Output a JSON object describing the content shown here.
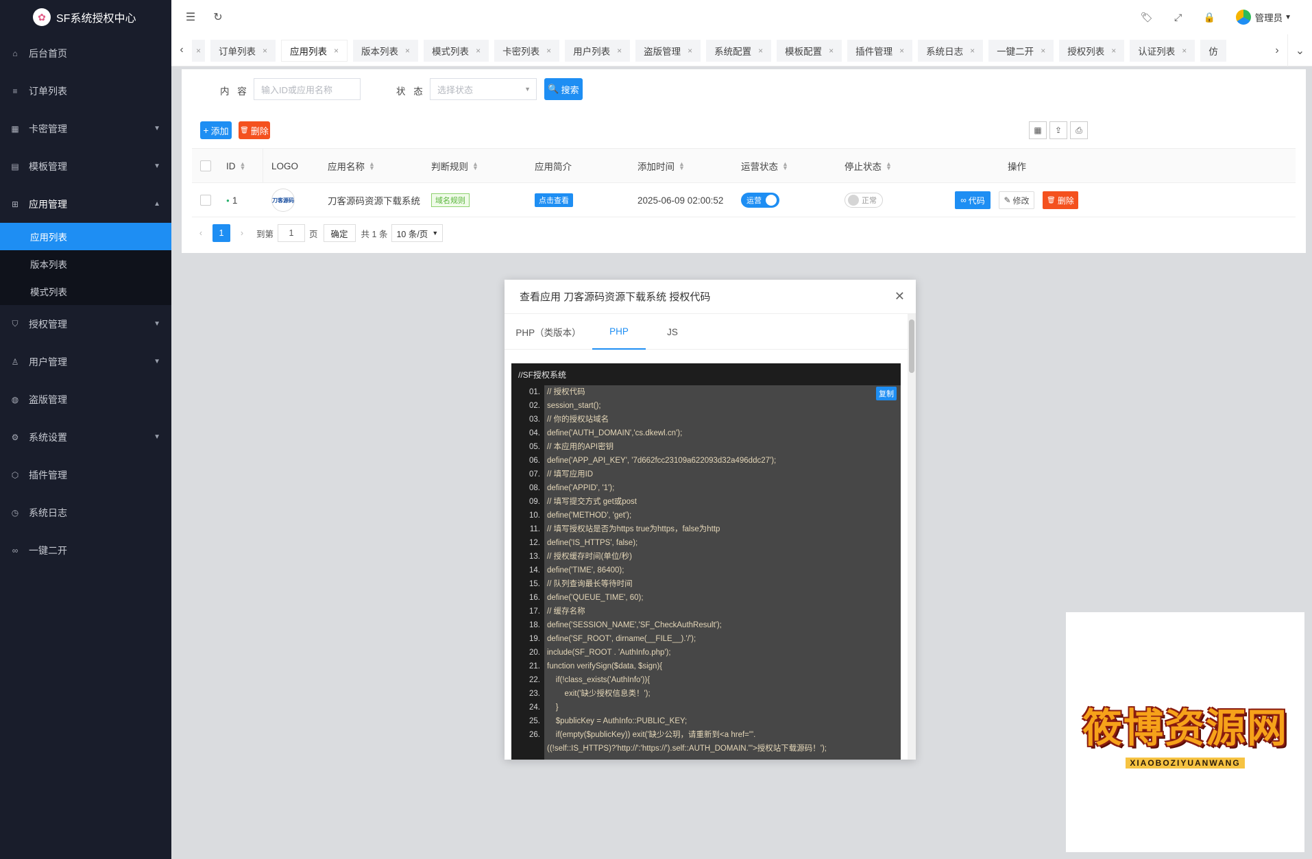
{
  "app": {
    "title": "SF系统授权中心"
  },
  "sidebar": {
    "items": [
      {
        "label": "后台首页",
        "icon": "home-icon",
        "has_children": false
      },
      {
        "label": "订单列表",
        "icon": "list-icon",
        "has_children": false
      },
      {
        "label": "卡密管理",
        "icon": "grid-icon",
        "has_children": true
      },
      {
        "label": "模板管理",
        "icon": "template-icon",
        "has_children": true
      },
      {
        "label": "应用管理",
        "icon": "apps-icon",
        "has_children": true,
        "open": true
      },
      {
        "label": "授权管理",
        "icon": "shield-icon",
        "has_children": true
      },
      {
        "label": "用户管理",
        "icon": "user-icon",
        "has_children": true
      },
      {
        "label": "盗版管理",
        "icon": "globe-icon",
        "has_children": false
      },
      {
        "label": "系统设置",
        "icon": "gear-icon",
        "has_children": true
      },
      {
        "label": "插件管理",
        "icon": "cube-icon",
        "has_children": false
      },
      {
        "label": "系统日志",
        "icon": "clock-icon",
        "has_children": false
      },
      {
        "label": "一键二开",
        "icon": "infinity-icon",
        "has_children": false
      }
    ],
    "sub_items": [
      {
        "label": "应用列表",
        "active": true
      },
      {
        "label": "版本列表",
        "active": false
      },
      {
        "label": "模式列表",
        "active": false
      }
    ]
  },
  "header": {
    "user": "管理员"
  },
  "tabs": [
    {
      "label": "订单列表",
      "active": false
    },
    {
      "label": "应用列表",
      "active": true
    },
    {
      "label": "版本列表",
      "active": false
    },
    {
      "label": "模式列表",
      "active": false
    },
    {
      "label": "卡密列表",
      "active": false
    },
    {
      "label": "用户列表",
      "active": false
    },
    {
      "label": "盗版管理",
      "active": false
    },
    {
      "label": "系统配置",
      "active": false
    },
    {
      "label": "模板配置",
      "active": false
    },
    {
      "label": "插件管理",
      "active": false
    },
    {
      "label": "系统日志",
      "active": false
    },
    {
      "label": "一键二开",
      "active": false
    },
    {
      "label": "授权列表",
      "active": false
    },
    {
      "label": "认证列表",
      "active": false
    },
    {
      "label": "仿",
      "active": false
    }
  ],
  "search": {
    "content_label": "内 容",
    "content_placeholder": "输入ID或应用名称",
    "status_label": "状 态",
    "status_placeholder": "选择状态",
    "button": "搜索"
  },
  "toolbar": {
    "add": "添加",
    "delete": "删除"
  },
  "table": {
    "headers": [
      "ID",
      "LOGO",
      "应用名称",
      "判断规则",
      "应用简介",
      "添加时间",
      "运营状态",
      "停止状态",
      "操作"
    ],
    "rows": [
      {
        "id": "1",
        "logo_text": "刀客源码",
        "name": "刀客源码资源下载系统",
        "rule": "域名规则",
        "intro": "点击查看",
        "time": "2025-06-09 02:00:52",
        "operate": "运营",
        "stop": "正常",
        "actions": {
          "code": "代码",
          "edit": "修改",
          "delete": "删除"
        }
      }
    ]
  },
  "pager": {
    "current": "1",
    "goto_label": "到第",
    "page_input": "1",
    "page_suffix": "页",
    "confirm": "确定",
    "total": "共 1 条",
    "per_page": "10 条/页"
  },
  "modal": {
    "title": "查看应用 刀客源码资源下载系统 授权代码",
    "tabs": [
      {
        "label": "PHP（类版本）",
        "active": false
      },
      {
        "label": "PHP",
        "active": true
      },
      {
        "label": "JS",
        "active": false
      }
    ],
    "code_title": "//SF授权系统",
    "copy": "复制",
    "line_numbers": [
      "01.",
      "02.",
      "03.",
      "04.",
      "05.",
      "06.",
      "07.",
      "08.",
      "09.",
      "10.",
      "11.",
      "12.",
      "13.",
      "14.",
      "15.",
      "16.",
      "17.",
      "18.",
      "19.",
      "20.",
      "21.",
      "22.",
      "23.",
      "24.",
      "25.",
      "26."
    ],
    "code_lines": [
      "// 授权代码",
      "session_start();",
      "// 你的授权站域名",
      "define('AUTH_DOMAIN','cs.dkewl.cn');",
      "// 本应用的API密钥",
      "define('APP_API_KEY', '7d662fcc23109a622093d32a496ddc27');",
      "// 填写应用ID",
      "define('APPID', '1');",
      "// 填写提交方式 get或post",
      "define('METHOD', 'get');",
      "// 填写授权站是否为https true为https，false为http",
      "define('IS_HTTPS', false);",
      "// 授权缓存时间(单位/秒)",
      "define('TIME', 86400);",
      "// 队列查询最长等待时间",
      "define('QUEUE_TIME', 60);",
      "// 缓存名称",
      "define('SESSION_NAME','SF_CheckAuthResult');",
      "define('SF_ROOT', dirname(__FILE__).'/');",
      "include(SF_ROOT . 'AuthInfo.php');",
      "function verifySign($data, $sign){",
      "    if(!class_exists('AuthInfo')){",
      "        exit('缺少授权信息类！');",
      "    }",
      "    $publicKey = AuthInfo::PUBLIC_KEY;",
      "    if(empty($publicKey)) exit('缺少公玥，请重新到<a href=\"'.",
      "((!self::IS_HTTPS)?'http://':'https://').self::AUTH_DOMAIN.'\">授权站下载源码！');"
    ]
  },
  "watermark": {
    "text": "筱博资源网",
    "sub": "XIAOBOZIYUANWANG"
  },
  "colors": {
    "sidebar_bg": "#191d2b",
    "accent": "#1e8ef3",
    "danger": "#f4511e"
  }
}
